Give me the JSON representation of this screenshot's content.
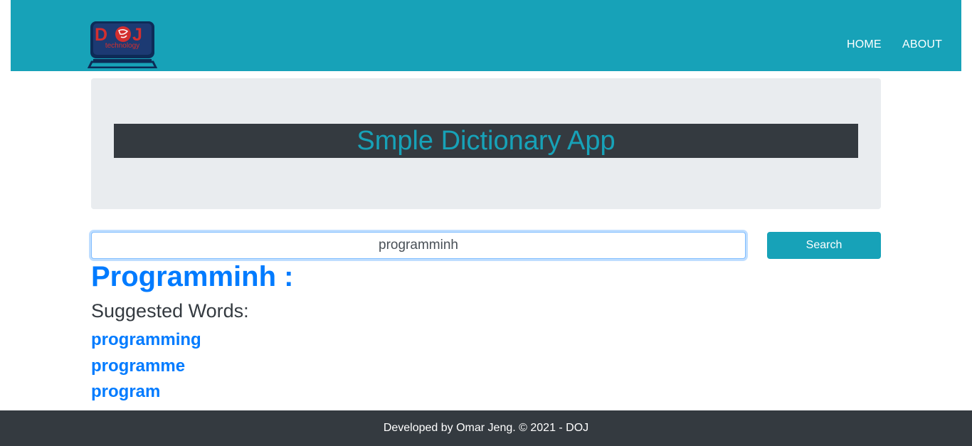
{
  "brand": {
    "logo_letters": "DOJ",
    "logo_subtext": "technology"
  },
  "nav": {
    "home": "HOME",
    "about": "ABOUT"
  },
  "header": {
    "title": "Smple Dictionary App"
  },
  "search": {
    "value": "programminh",
    "button_label": "Search"
  },
  "result": {
    "word_heading": "Programminh :",
    "suggested_label": "Suggested Words:",
    "suggestions": [
      "programming",
      "programme",
      "program"
    ]
  },
  "footer": {
    "text": "Developed by Omar Jeng. © 2021 - DOJ"
  },
  "colors": {
    "primary": "#17a2b8",
    "dark": "#343a40",
    "link": "#007bff",
    "jumbotron": "#e9ecef",
    "logo_red": "#d32f2f",
    "logo_navy": "#0d2b57"
  }
}
